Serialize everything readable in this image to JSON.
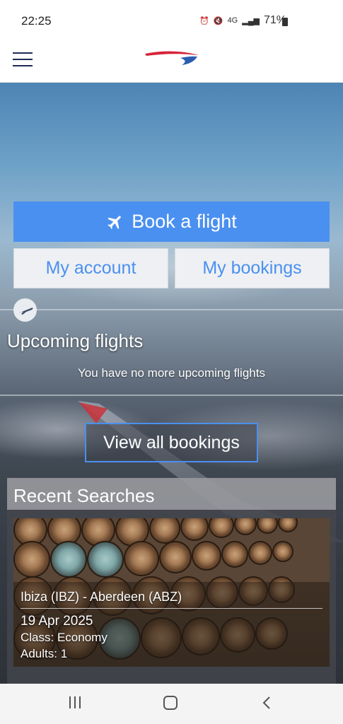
{
  "status_bar": {
    "time": "22:25",
    "network": "4G",
    "battery": "71%"
  },
  "app": {
    "brand_colors": {
      "primary": "#4a90f0",
      "navy": "#1d2c56",
      "red": "#d6243a"
    }
  },
  "actions": {
    "book_flight": "Book a flight",
    "my_account": "My account",
    "my_bookings": "My bookings"
  },
  "upcoming": {
    "title": "Upcoming flights",
    "message": "You have no more upcoming flights",
    "view_all": "View all bookings"
  },
  "recent_searches": {
    "title": "Recent Searches",
    "items": [
      {
        "route": "Ibiza (IBZ) - Aberdeen (ABZ)",
        "date": "19 Apr 2025",
        "class": "Class: Economy",
        "adults": "Adults: 1"
      }
    ]
  },
  "nav": {
    "icons": [
      "recents-icon",
      "home-icon",
      "back-icon"
    ]
  }
}
